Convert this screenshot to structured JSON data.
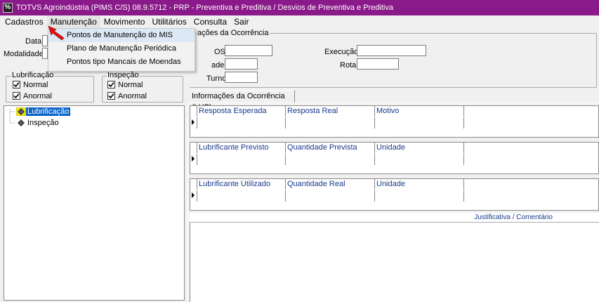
{
  "window": {
    "title": "TOTVS Agroindústria (PIMS C/S) 08.9.5712 - PRP - Preventiva e Preditiva / Desvios de Preventiva e Preditiva",
    "icon_letter": "%"
  },
  "menubar": {
    "items": [
      "Cadastros",
      "Manutenção",
      "Movimento",
      "Utilitários",
      "Consulta",
      "Sair"
    ]
  },
  "dropdown": {
    "items": [
      "Pontos de Manutenção do MIS",
      "Plano de Manutenção Periódica",
      "Pontos tipo Mancais de Moendas"
    ]
  },
  "left_form": {
    "data_label": "Data",
    "modalidade_label": "Modalidade"
  },
  "groups": {
    "lubrificacao": {
      "title": "Lubrificação",
      "normal": "Normal",
      "anormal": "Anormal"
    },
    "inspecao": {
      "title": "Inspeção",
      "normal": "Normal",
      "anormal": "Anormal"
    }
  },
  "tree": {
    "items": [
      "Lubrificação",
      "Inspeção"
    ]
  },
  "ocorrencia": {
    "group_title": "ações da Ocorrência",
    "os_label": "OS",
    "ade_label": "ade",
    "turno_label": "Turno",
    "execucao_label": "Execução",
    "rota_label": "Rota"
  },
  "tab": {
    "label": "Informações da Ocorrência (LUB)"
  },
  "grid1": {
    "headers": [
      "Resposta Esperada",
      "Resposta Real",
      "Motivo"
    ]
  },
  "grid2": {
    "headers": [
      "Lubrificante Previsto",
      "Quantidade Prevista",
      "Unidade"
    ]
  },
  "grid3": {
    "headers": [
      "Lubrificante Utilizado",
      "Quantidade Real",
      "Unidade"
    ]
  },
  "justificativa": {
    "header": "Justificativa / Comentário"
  },
  "colors": {
    "titlebar": "#8a1a8a",
    "selection": "#0a64c8",
    "grid_header_text": "#1a3a8a",
    "arrow": "#e01010"
  }
}
